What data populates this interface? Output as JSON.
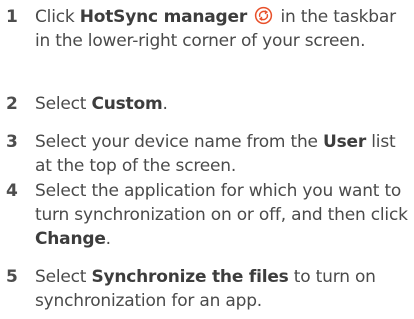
{
  "steps": [
    {
      "number": "1",
      "parts": [
        "Click ",
        "HotSync manager",
        " in the taskbar in the lower-right corner of your screen."
      ],
      "icon": "hotsync-icon",
      "icon_color": "#e8502a"
    },
    {
      "number": "2",
      "parts": [
        "Select ",
        "Custom",
        "."
      ]
    },
    {
      "number": "3",
      "parts": [
        "Select your device name from the ",
        "User",
        " list at the top of the screen."
      ]
    },
    {
      "number": "4",
      "parts": [
        "Select the application for which you want to turn synchronization on or off, and then click ",
        "Change",
        "."
      ]
    },
    {
      "number": "5",
      "parts": [
        "Select ",
        "Synchronize the files",
        " to turn on synchronization for an app."
      ]
    }
  ]
}
